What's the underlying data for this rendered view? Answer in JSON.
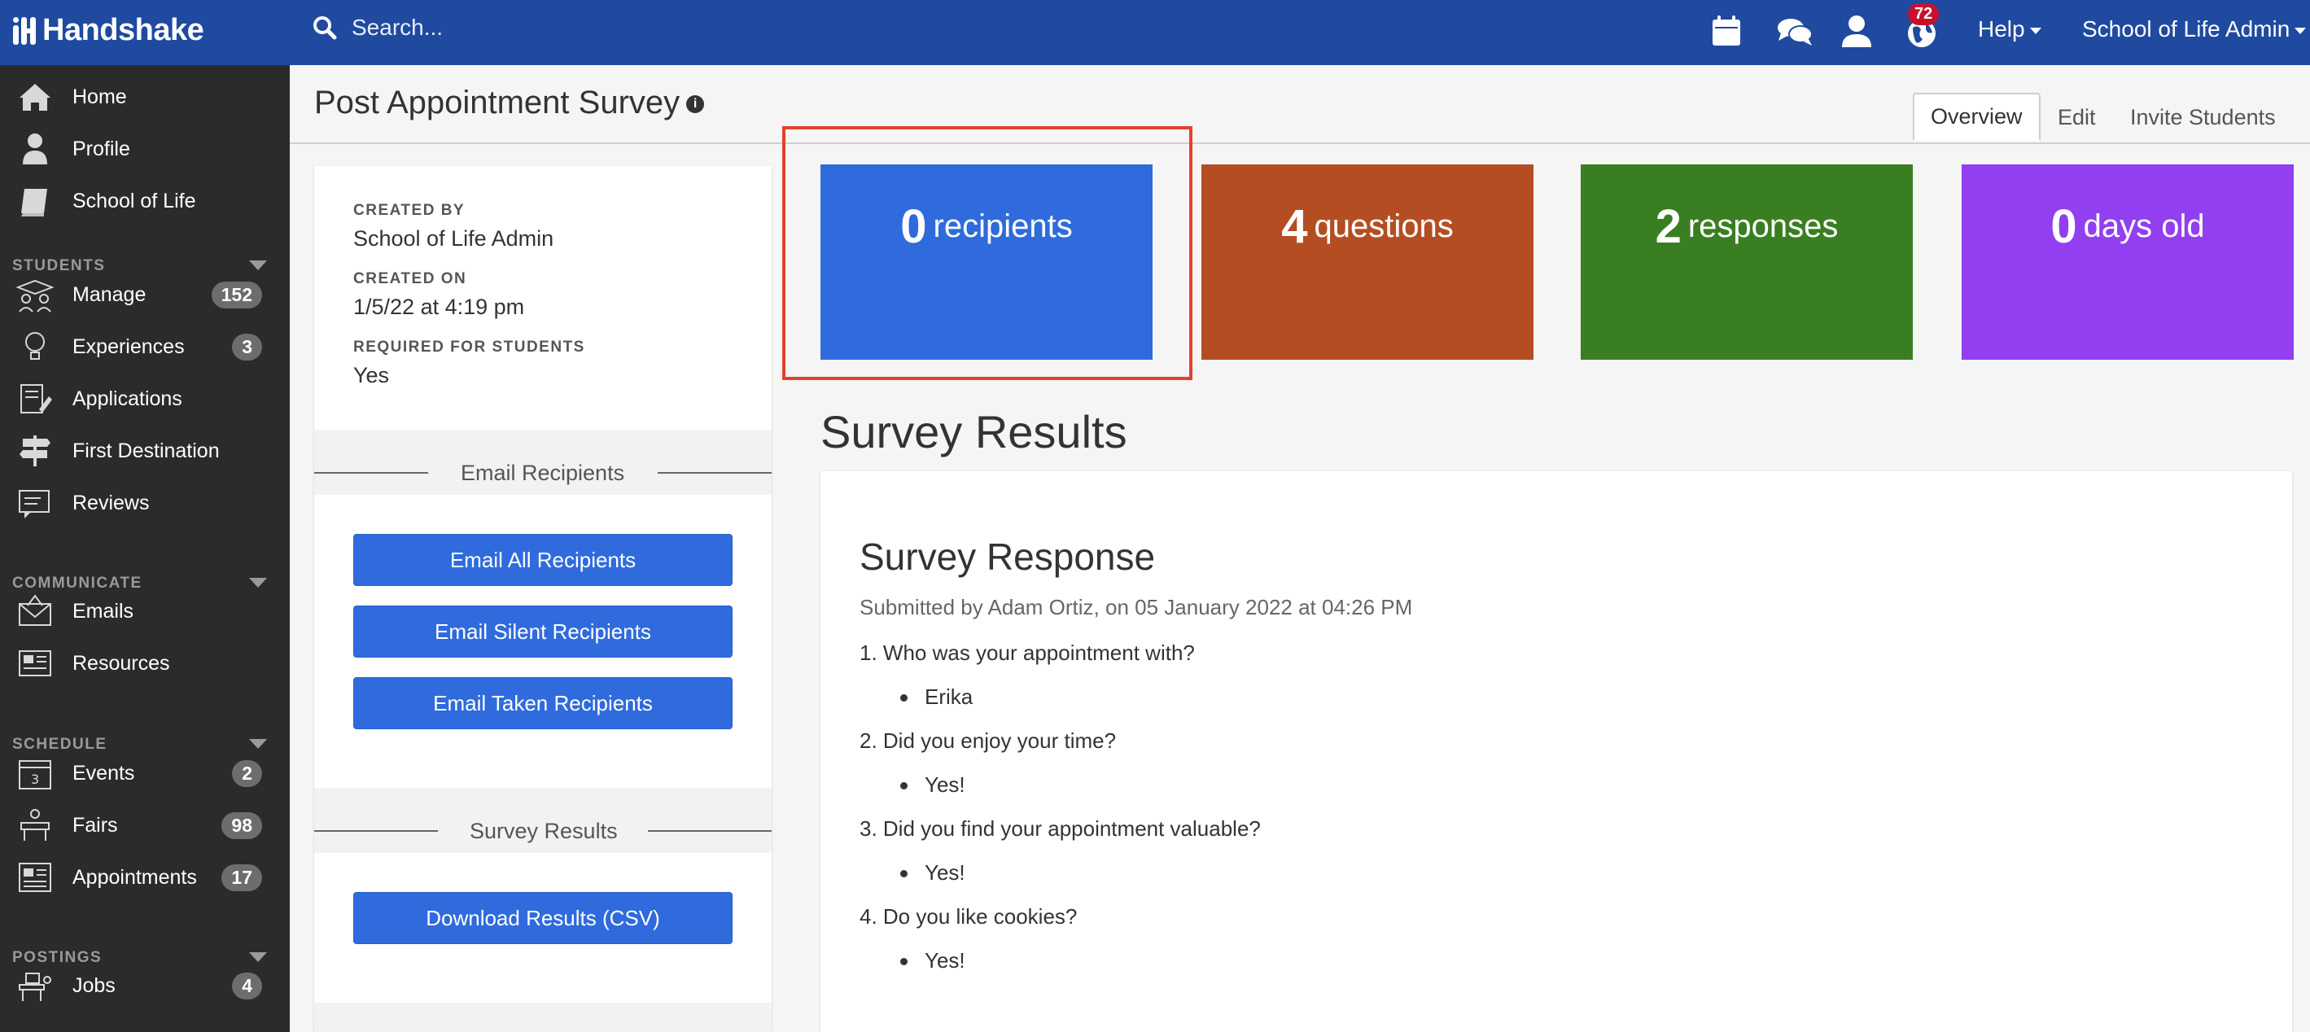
{
  "header": {
    "logo_text": "Handshake",
    "search_placeholder": "Search...",
    "notification_count": "72",
    "help_label": "Help",
    "user_menu_label": "School of Life Admin"
  },
  "sidebar": {
    "top_items": [
      {
        "label": "Home",
        "icon": "home-icon"
      },
      {
        "label": "Profile",
        "icon": "person-icon"
      },
      {
        "label": "School of Life",
        "icon": "book-icon"
      }
    ],
    "sections": [
      {
        "heading": "STUDENTS",
        "items": [
          {
            "label": "Manage",
            "count": "152",
            "icon": "students-icon"
          },
          {
            "label": "Experiences",
            "count": "3",
            "icon": "lightbulb-icon"
          },
          {
            "label": "Applications",
            "count": "",
            "icon": "applications-icon"
          },
          {
            "label": "First Destination",
            "count": "",
            "icon": "signpost-icon"
          },
          {
            "label": "Reviews",
            "count": "",
            "icon": "reviews-icon"
          }
        ]
      },
      {
        "heading": "COMMUNICATE",
        "items": [
          {
            "label": "Emails",
            "count": "",
            "icon": "envelope-icon"
          },
          {
            "label": "Resources",
            "count": "",
            "icon": "resources-icon"
          }
        ]
      },
      {
        "heading": "SCHEDULE",
        "items": [
          {
            "label": "Events",
            "count": "2",
            "icon": "calendar-icon"
          },
          {
            "label": "Fairs",
            "count": "98",
            "icon": "fairs-icon"
          },
          {
            "label": "Appointments",
            "count": "17",
            "icon": "appointments-icon"
          }
        ]
      },
      {
        "heading": "POSTINGS",
        "items": [
          {
            "label": "Jobs",
            "count": "4",
            "icon": "jobs-icon"
          }
        ]
      }
    ]
  },
  "page": {
    "title": "Post Appointment Survey",
    "tabs": [
      "Overview",
      "Edit",
      "Invite Students"
    ],
    "active_tab": "Overview"
  },
  "details": {
    "created_by_label": "CREATED BY",
    "created_by": "School of Life Admin",
    "created_on_label": "CREATED ON",
    "created_on": "1/5/22 at 4:19 pm",
    "required_label": "REQUIRED FOR STUDENTS",
    "required": "Yes"
  },
  "email_section": {
    "heading": "Email Recipients",
    "buttons": [
      "Email All Recipients",
      "Email Silent Recipients",
      "Email Taken Recipients"
    ]
  },
  "results_section": {
    "heading": "Survey Results",
    "download_label": "Download Results (CSV)"
  },
  "stats": [
    {
      "value": "0",
      "label": "recipients",
      "color": "#2f6bdc"
    },
    {
      "value": "4",
      "label": "questions",
      "color": "#b44e22"
    },
    {
      "value": "2",
      "label": "responses",
      "color": "#3a7e22"
    },
    {
      "value": "0",
      "label": "days old",
      "color": "#913ff0"
    }
  ],
  "survey_results": {
    "title": "Survey Results",
    "response_title": "Survey Response",
    "submitted_by": "Submitted by Adam Ortiz, on 05 January 2022 at 04:26 PM",
    "questions": [
      {
        "q": "1. Who was your appointment with?",
        "a": "Erika"
      },
      {
        "q": "2. Did you enjoy your time?",
        "a": "Yes!"
      },
      {
        "q": "3. Did you find your appointment valuable?",
        "a": "Yes!"
      },
      {
        "q": "4. Do you like cookies?",
        "a": "Yes!"
      }
    ]
  },
  "colors": {
    "header_bg": "#1f4aa0",
    "sidebar_bg": "#2b2b2b",
    "primary_button": "#2f6bdc",
    "highlight_border": "#e0432b"
  }
}
